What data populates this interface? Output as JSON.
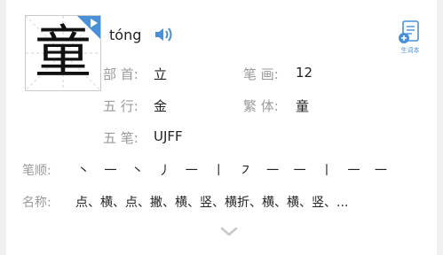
{
  "character": {
    "glyph": "童",
    "pinyin": "tóng"
  },
  "info": {
    "radical_label": "部 首:",
    "radical_value": "立",
    "strokes_label": "笔 画:",
    "strokes_value": "12",
    "element_label": "五 行:",
    "element_value": "金",
    "traditional_label": "繁 体:",
    "traditional_value": "童",
    "wubi_label": "五 笔:",
    "wubi_value": "UJFF"
  },
  "stroke_order": {
    "label": "笔顺:",
    "value": "丶 一 丶 丿 一 丨 ㇇ 一 一 丨 一 一"
  },
  "stroke_names": {
    "label": "名称:",
    "value": "点、横、点、撇、横、竖、横折、横、横、竖、..."
  },
  "wordbook": {
    "label": "生词本"
  },
  "colors": {
    "accent": "#4a90d9",
    "label_gray": "#9a9a9a",
    "text": "#222222"
  },
  "icons": {
    "play": "play-icon",
    "speaker": "speaker-icon",
    "wordbook": "wordbook-icon",
    "expand": "chevron-down-icon"
  }
}
